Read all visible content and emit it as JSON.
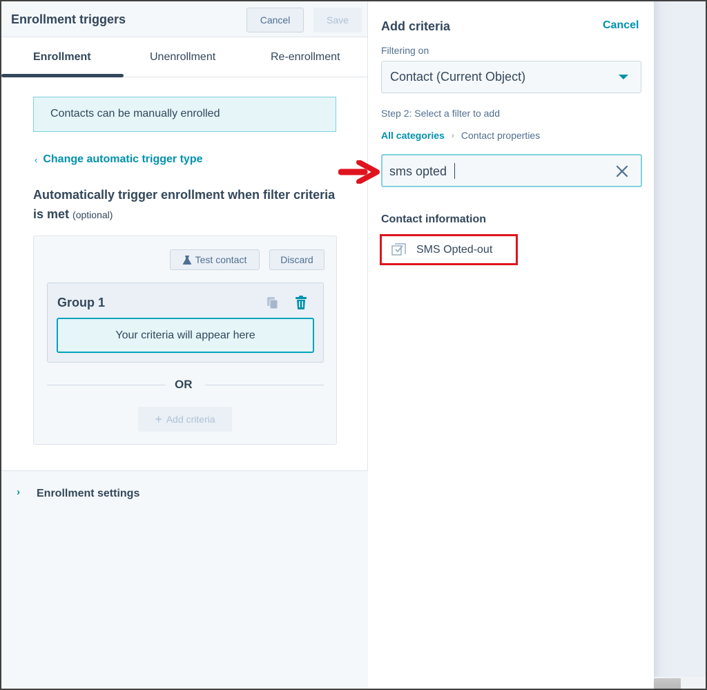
{
  "left_panel": {
    "title": "Enrollment triggers",
    "cancel_label": "Cancel",
    "save_label": "Save",
    "tabs": [
      {
        "label": "Enrollment",
        "active": true
      },
      {
        "label": "Unenrollment",
        "active": false
      },
      {
        "label": "Re-enrollment",
        "active": false
      }
    ],
    "info_text": "Contacts can be manually enrolled",
    "change_trigger_link": "Change automatic trigger type",
    "auto_heading": "Automatically trigger enrollment when filter criteria is met",
    "optional_label": "(optional)",
    "criteria": {
      "test_contact_label": "Test contact",
      "discard_label": "Discard",
      "group_title": "Group 1",
      "placeholder": "Your criteria will appear here",
      "or_label": "OR",
      "add_criteria_label": "Add criteria"
    },
    "settings_label": "Enrollment settings"
  },
  "right_panel": {
    "title": "Add criteria",
    "cancel_label": "Cancel",
    "filtering_on_label": "Filtering on",
    "object_select_value": "Contact (Current Object)",
    "step_label": "Step 2: Select a filter to add",
    "breadcrumb": {
      "root": "All categories",
      "current": "Contact properties"
    },
    "search": {
      "value": "sms opted",
      "placeholder": ""
    },
    "results": [
      {
        "section": "Contact information",
        "items": [
          {
            "label": "SMS Opted-out",
            "icon": "checkbox-property-icon",
            "highlighted": true
          }
        ]
      }
    ]
  },
  "colors": {
    "accent": "#0091ae",
    "text": "#33475b",
    "highlight_red": "#e0141e",
    "info_bg": "#e5f5f8",
    "panel_bg": "#f5f8fa"
  }
}
